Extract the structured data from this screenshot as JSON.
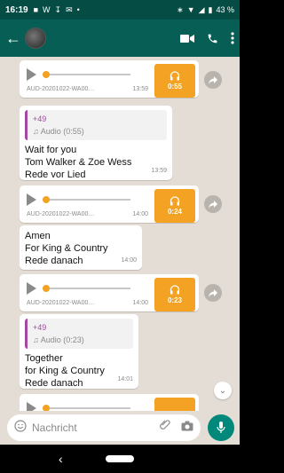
{
  "status": {
    "time": "16:19",
    "battery": "43 %"
  },
  "chat_messages": [
    {
      "type": "audio",
      "file": "AUD-20201022-WA0001...",
      "time": "13:59",
      "duration": "0:55"
    },
    {
      "type": "text",
      "quote_from": "+49",
      "quote_audio": "Audio (0:55)",
      "lines": [
        "Wait for you",
        "Tom Walker & Zoe Wess",
        "Rede vor Lied"
      ],
      "time": "13:59"
    },
    {
      "type": "audio",
      "file": "AUD-20201022-WA0002...",
      "time": "14:00",
      "duration": "0:24"
    },
    {
      "type": "text",
      "lines": [
        "Amen",
        "For King & Country",
        "Rede danach"
      ],
      "time": "14:00"
    },
    {
      "type": "audio",
      "file": "AUD-20201022-WA0003...",
      "time": "14:00",
      "duration": "0:23"
    },
    {
      "type": "text",
      "quote_from": "+49",
      "quote_audio": "Audio (0:23)",
      "lines": [
        "Together",
        "for King & Country",
        "Rede danach"
      ],
      "time": "14:01"
    }
  ],
  "composer": {
    "placeholder": "Nachricht"
  },
  "colors": {
    "header": "#075e54",
    "status_bar": "#054d44",
    "accent_audio": "#f3a223",
    "quote_bar": "#a349a4",
    "send_button": "#00897b"
  },
  "icons": {
    "back": "arrow-left-icon",
    "video": "video-icon",
    "call": "phone-icon",
    "menu": "more-vert-icon",
    "emoji": "emoji-icon",
    "attach": "paperclip-icon",
    "camera": "camera-icon",
    "mic": "mic-icon",
    "share": "forward-icon",
    "scroll": "chevron-double-down-icon"
  }
}
